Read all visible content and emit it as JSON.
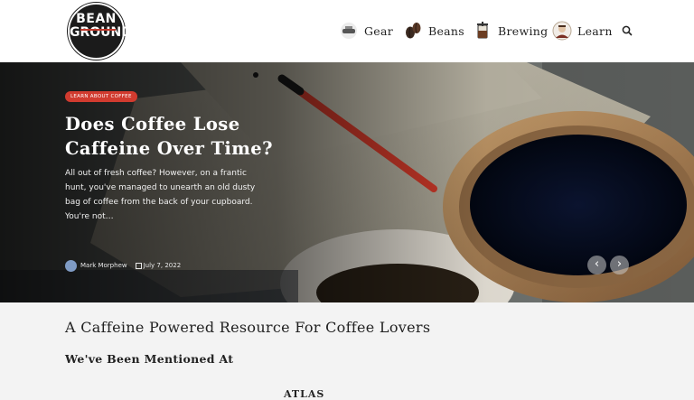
{
  "logo": {
    "top": "BEAN",
    "bottom": "GROUND"
  },
  "nav": {
    "items": [
      {
        "label": "Gear",
        "icon": "grinder-icon"
      },
      {
        "label": "Beans",
        "icon": "coffee-beans-icon"
      },
      {
        "label": "Brewing",
        "icon": "french-press-icon"
      },
      {
        "label": "Learn",
        "icon": "barista-icon"
      }
    ],
    "search_icon": "search-icon"
  },
  "hero": {
    "category": "Learn About Coffee",
    "title": "Does Coffee Lose Caffeine Over Time?",
    "excerpt": "All out of fresh coffee? However, on a frantic hunt, you've managed to unearth an old dusty bag of coffee from the back of your cupboard. You're not…",
    "author": "Mark Morphew",
    "date": "July 7, 2022",
    "prev_label": "‹",
    "next_label": "›"
  },
  "content": {
    "tagline": "A Caffeine Powered Resource For Coffee Lovers",
    "mentioned_heading": "We've Been Mentioned At",
    "press_logo_partial": "ATLAS"
  },
  "colors": {
    "accent": "#d13b2f",
    "page_bg": "#f3f3f3",
    "text": "#222222"
  }
}
